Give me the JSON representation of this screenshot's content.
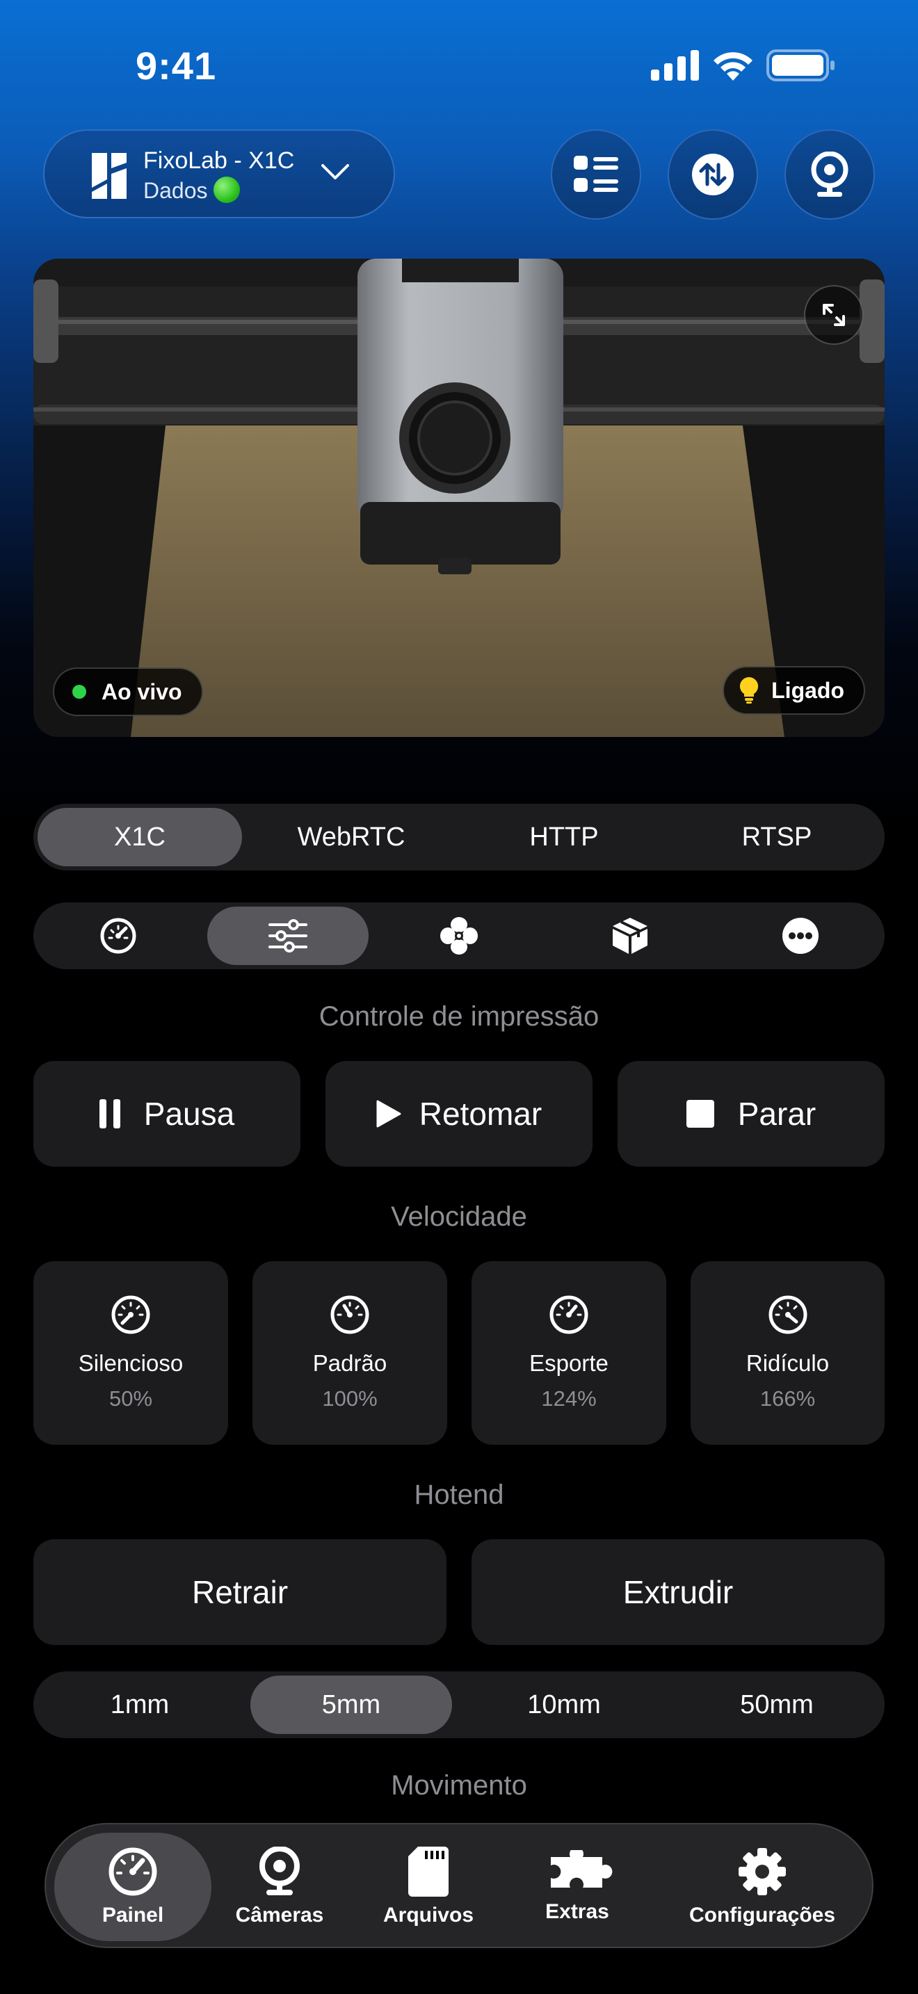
{
  "status_bar": {
    "time": "9:41"
  },
  "header": {
    "printer_name": "FixoLab - X1C",
    "printer_subtitle": "Dados",
    "status_color": "#2cc21c"
  },
  "camera": {
    "live_label": "Ao vivo",
    "light_label": "Ligado",
    "live_color": "#2fd34a"
  },
  "stream_tabs": {
    "items": [
      "X1C",
      "WebRTC",
      "HTTP",
      "RTSP"
    ],
    "selected": "X1C"
  },
  "control_tabs": {
    "icons": [
      "speedometer-icon",
      "sliders-icon",
      "fan-icon",
      "box-icon",
      "more-icon"
    ],
    "selected": "sliders-icon"
  },
  "print_control": {
    "title": "Controle de impressão",
    "pause_label": "Pausa",
    "resume_label": "Retomar",
    "stop_label": "Parar"
  },
  "speed": {
    "title": "Velocidade",
    "modes": [
      {
        "name": "Silencioso",
        "percent": "50%"
      },
      {
        "name": "Padrão",
        "percent": "100%"
      },
      {
        "name": "Esporte",
        "percent": "124%"
      },
      {
        "name": "Ridículo",
        "percent": "166%"
      }
    ]
  },
  "hotend": {
    "title": "Hotend",
    "retract_label": "Retrair",
    "extrude_label": "Extrudir",
    "distances": [
      "1mm",
      "5mm",
      "10mm",
      "50mm"
    ],
    "selected_distance": "5mm"
  },
  "movement": {
    "title": "Movimento"
  },
  "tab_bar": {
    "items": [
      {
        "label": "Painel",
        "icon": "gauge-icon"
      },
      {
        "label": "Câmeras",
        "icon": "webcam-icon"
      },
      {
        "label": "Arquivos",
        "icon": "sd-card-icon"
      },
      {
        "label": "Extras",
        "icon": "puzzle-icon"
      },
      {
        "label": "Configurações",
        "icon": "gear-icon"
      }
    ],
    "selected": "Painel"
  }
}
